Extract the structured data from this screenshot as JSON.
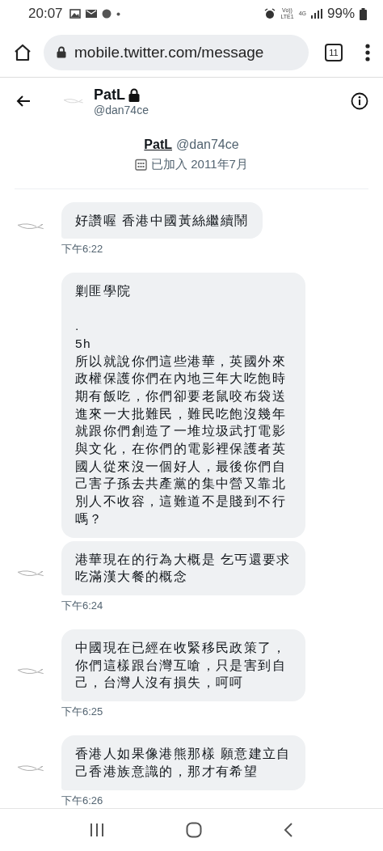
{
  "status_bar": {
    "time": "20:07",
    "volte": "Vo))",
    "lte": "LTE1",
    "network": "4G",
    "battery": "99%"
  },
  "browser": {
    "url": "mobile.twitter.com/message",
    "tab_count": "11"
  },
  "header": {
    "name": "PatL",
    "handle": "@dan74ce"
  },
  "profile": {
    "name": "PatL",
    "handle": "@dan74ce",
    "joined": "已加入 2011年7月"
  },
  "messages": [
    {
      "bubbles": [
        {
          "paragraphs": [
            "好讚喔 香港中國黃絲繼續鬧"
          ]
        }
      ],
      "time": "下午6:22"
    },
    {
      "bubbles": [
        {
          "paragraphs": [
            "剿匪學院",
            ".",
            "5h",
            "所以就說你們這些港華，英國外來政權保護你們在內地三年大吃飽時期有飯吃，你們卻要老鼠咬布袋送進來一大批難民，難民吃飽沒幾年就跟你們創造了一堆垃圾武打電影與文化，在你們的電影裡保護者英國人從來沒一個好人，最後你們自己害子孫去共產黨的集中營又靠北別人不收容，這難道不是賤到不行嗎？"
          ]
        },
        {
          "paragraphs": [
            "港華現在的行為大概是 乞丐還要求吃滿漢大餐的概念"
          ]
        }
      ],
      "time": "下午6:24"
    },
    {
      "bubbles": [
        {
          "paragraphs": [
            "中國現在已經在收緊移民政策了，你們這樣跟台灣互嗆，只是害到自己，台灣人沒有損失，呵呵"
          ]
        }
      ],
      "time": "下午6:25"
    },
    {
      "bubbles": [
        {
          "paragraphs": [
            "香港人如果像港熊那樣 願意建立自己香港族意識的，那才有希望"
          ]
        }
      ],
      "time": "下午6:26"
    }
  ]
}
